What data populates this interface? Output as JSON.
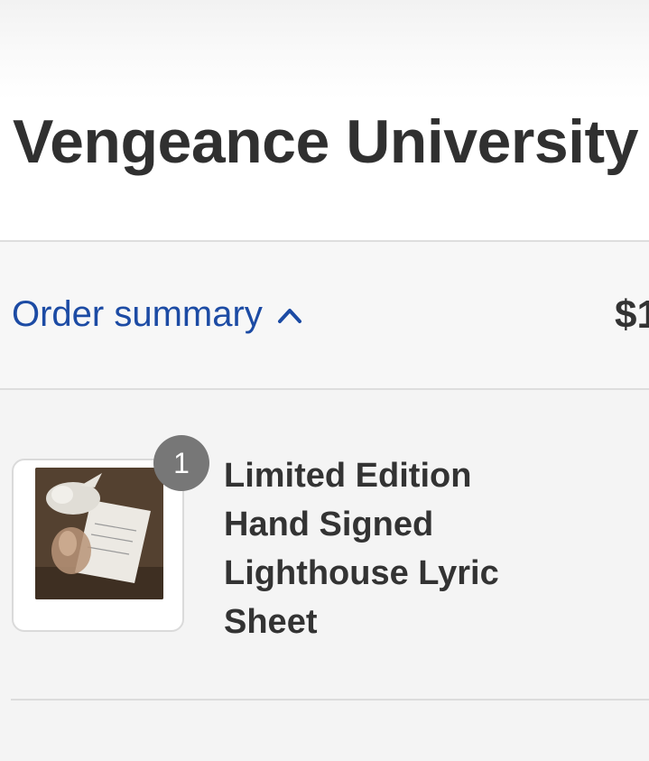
{
  "store": {
    "title": "Vengeance University"
  },
  "order_summary": {
    "toggle_label": "Order summary",
    "toggle_icon": "chevron-up-icon",
    "total_price": "$1",
    "accent_color": "#1c4ba4"
  },
  "line_items": [
    {
      "quantity": "1",
      "name": "Limited Edition Hand Signed Lighthouse Lyric Sheet"
    }
  ]
}
